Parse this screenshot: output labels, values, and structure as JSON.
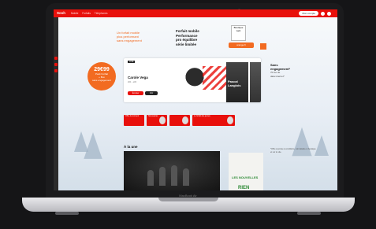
{
  "device": {
    "label": "MacBook Air"
  },
  "header": {
    "logo": "Sosh",
    "nav": [
      "Mobile",
      "Forfaits",
      "Téléphones"
    ],
    "cta": "Mon compte"
  },
  "promo_badge": {
    "price": "29€99",
    "line1": "Pack Forfait",
    "line2": "+ Box",
    "line3": "sans engagement"
  },
  "hero": {
    "left_lines": [
      "Un forfait mobile",
      "plus performant",
      "sans engagement"
    ],
    "mid_lines": [
      "Forfait mobile",
      "Performance",
      "pro équilibre",
      "série limitée"
    ],
    "sticker": [
      "Boutique",
      "web"
    ],
    "button": "orange.fr"
  },
  "card": {
    "tag": "LIVE",
    "name": "Carole Vega",
    "time": "20h – 22h",
    "btn_primary": "Écouter",
    "btn_secondary": "Voir",
    "person2": "Pascal Langlois"
  },
  "side_offer": {
    "line1": "Sans",
    "line2": "engagement*",
    "line3": "70 Go de",
    "line4": "data internet*"
  },
  "row_cards": [
    "Offre du moment",
    "Nouveautés",
    "",
    "Le forfait des jeunes"
  ],
  "section": {
    "title": "À la une"
  },
  "book": {
    "line1": "LES NOUVELLES",
    "line2": "RIEN"
  },
  "footnote": "*Offre soumise à conditions, voir détails en boutique et sur le site."
}
